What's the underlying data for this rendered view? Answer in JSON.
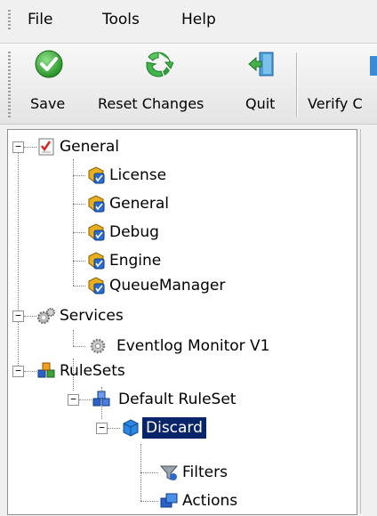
{
  "menu": {
    "file": "File",
    "tools": "Tools",
    "help": "Help"
  },
  "toolbar": {
    "save": "Save",
    "reset": "Reset Changes",
    "quit": "Quit",
    "verify": "Verify C"
  },
  "tree": {
    "general": "General",
    "license": "License",
    "general_child": "General",
    "debug": "Debug",
    "engine": "Engine",
    "queue_manager": "QueueManager",
    "services": "Services",
    "eventlog_monitor": "Eventlog Monitor V1",
    "rulesets": "RuleSets",
    "default_ruleset": "Default RuleSet",
    "discard": "Discard",
    "filters": "Filters",
    "actions": "Actions"
  },
  "colors": {
    "selection": "#0a246a",
    "window_bg": "#f0f0f0"
  }
}
